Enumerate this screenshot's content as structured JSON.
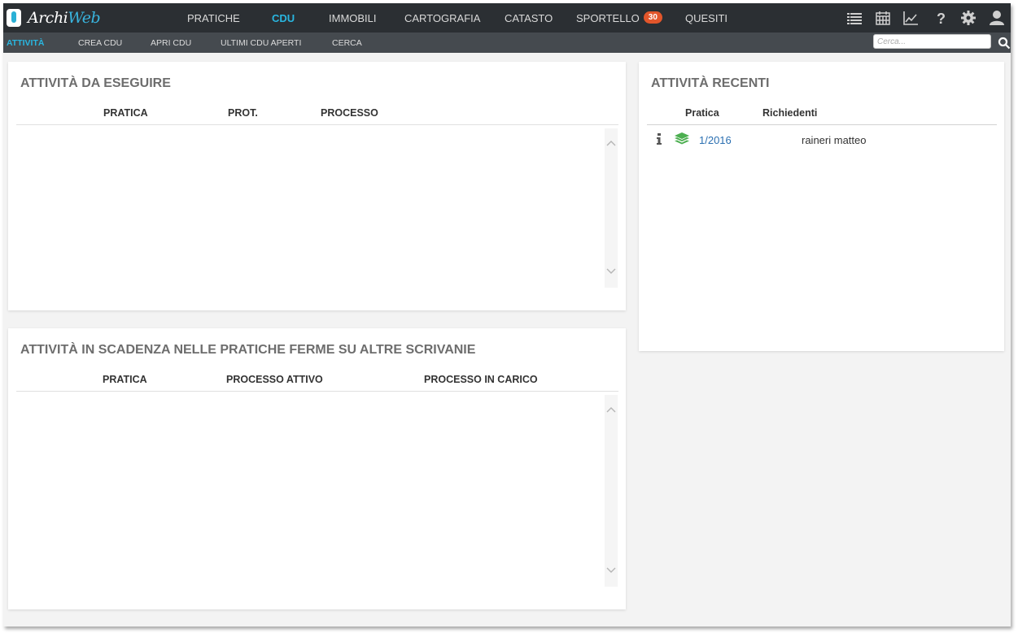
{
  "app": {
    "logo_left": "Archi",
    "logo_right": "Web"
  },
  "nav": {
    "items": [
      {
        "label": "PRATICHE",
        "active": false
      },
      {
        "label": "CDU",
        "active": true
      },
      {
        "label": "IMMOBILI",
        "active": false
      },
      {
        "label": "CARTOGRAFIA",
        "active": false
      },
      {
        "label": "CATASTO",
        "active": false
      },
      {
        "label": "SPORTELLO",
        "active": false,
        "badge": "30"
      },
      {
        "label": "QUESITI",
        "active": false
      }
    ],
    "icons": [
      "list-icon",
      "calendar-icon",
      "chart-icon",
      "help-icon",
      "gear-icon",
      "user-icon"
    ]
  },
  "subnav": {
    "items": [
      {
        "label": "ATTIVITÀ",
        "active": true
      },
      {
        "label": "CREA CDU",
        "active": false
      },
      {
        "label": "APRI CDU",
        "active": false
      },
      {
        "label": "ULTIMI CDU APERTI",
        "active": false
      },
      {
        "label": "CERCA",
        "active": false
      }
    ],
    "search_placeholder": "Cerca...",
    "search_value": ""
  },
  "todo_panel": {
    "title": "ATTIVITÀ DA ESEGUIRE",
    "columns": [
      "PRATICA",
      "PROT.",
      "PROCESSO"
    ],
    "rows": []
  },
  "deadline_panel": {
    "title": "ATTIVITÀ IN SCADENZA NELLE PRATICHE FERME SU ALTRE SCRIVANIE",
    "columns": [
      "PRATICA",
      "PROCESSO ATTIVO",
      "PROCESSO IN CARICO"
    ],
    "rows": []
  },
  "recent_panel": {
    "title": "ATTIVITÀ RECENTI",
    "columns": [
      "Pratica",
      "Richiedenti"
    ],
    "rows": [
      {
        "icons": [
          "info-icon",
          "layers-icon"
        ],
        "pratica": "1/2016",
        "richiedenti": "raineri matteo"
      }
    ]
  },
  "colors": {
    "accent": "#29b6e0",
    "topbar": "#2b2f33",
    "subbar": "#454a4f",
    "badge": "#e2562b",
    "layers": "#4caf50",
    "link": "#2a6fb1"
  }
}
